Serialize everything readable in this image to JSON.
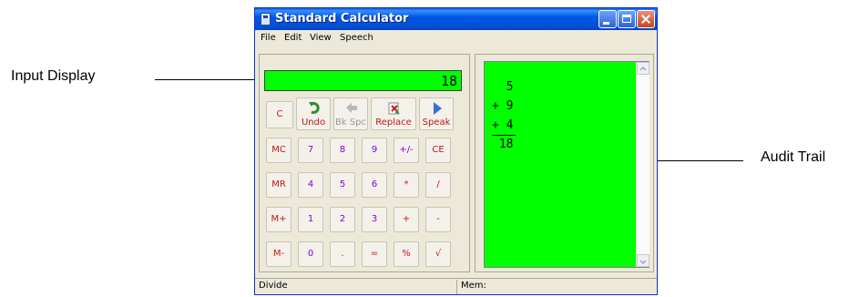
{
  "callouts": {
    "input_display": "Input Display",
    "audit_trail": "Audit Trail"
  },
  "window": {
    "title": "Standard Calculator"
  },
  "menu": [
    "File",
    "Edit",
    "View",
    "Speech"
  ],
  "display": {
    "value": "18"
  },
  "top_buttons": [
    {
      "label": "C"
    },
    {
      "label": "Undo",
      "icon": "undo-arrow-icon"
    },
    {
      "label": "Bk Spc",
      "icon": "back-arrow-icon"
    },
    {
      "label": "Replace",
      "icon": "replace-icon"
    },
    {
      "label": "Speak",
      "icon": "play-triangle-icon"
    }
  ],
  "keypad": [
    [
      "MC",
      "7",
      "8",
      "9",
      "+/-",
      "CE"
    ],
    [
      "MR",
      "4",
      "5",
      "6",
      "*",
      "/"
    ],
    [
      "M+",
      "1",
      "2",
      "3",
      "+",
      "-"
    ],
    [
      "M-",
      "0",
      ".",
      "=",
      "%",
      "√"
    ]
  ],
  "audit_trail": {
    "lines": [
      "  5",
      "+ 9",
      "+ 4",
      " 18"
    ]
  },
  "status": {
    "left": "Divide",
    "right": "Mem:"
  },
  "colors": {
    "display_bg": "#00ff00",
    "red_key": "#c01818",
    "purple_key": "#8b00d4"
  }
}
